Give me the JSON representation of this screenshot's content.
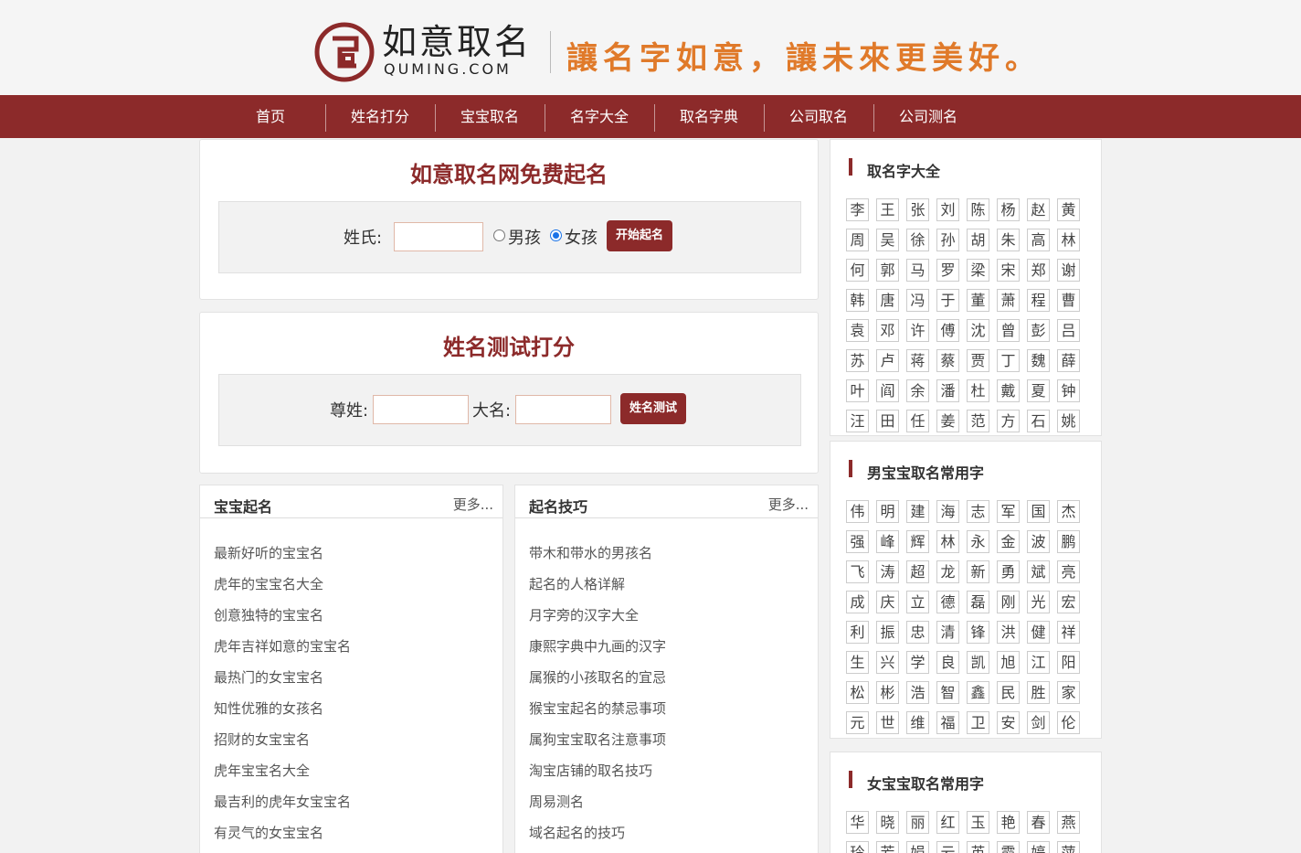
{
  "header": {
    "logo_title": "如意取名",
    "logo_sub": "QUMING.COM",
    "slogan": "讓名字如意，讓未來更美好。"
  },
  "nav": [
    "首页",
    "姓名打分",
    "宝宝取名",
    "名字大全",
    "取名字典",
    "公司取名",
    "公司测名"
  ],
  "naming_form": {
    "title": "如意取名网免费起名",
    "surname_label": "姓氏:",
    "surname_value": "",
    "boy_label": "男孩",
    "girl_label": "女孩",
    "selected_gender": "女孩",
    "submit_label": "开始起名"
  },
  "test_form": {
    "title": "姓名测试打分",
    "surname_label": "尊姓:",
    "surname_value": "",
    "name_label": "大名:",
    "name_value": "",
    "submit_label": "姓名测试"
  },
  "baby_naming": {
    "title": "宝宝起名",
    "more": "更多...",
    "items": [
      "最新好听的宝宝名",
      "虎年的宝宝名大全",
      "创意独特的宝宝名",
      "虎年吉祥如意的宝宝名",
      "最热门的女宝宝名",
      "知性优雅的女孩名",
      "招财的女宝宝名",
      "虎年宝宝名大全",
      "最吉利的虎年女宝宝名",
      "有灵气的女宝宝名"
    ]
  },
  "naming_tips": {
    "title": "起名技巧",
    "more": "更多...",
    "items": [
      "带木和带水的男孩名",
      "起名的人格详解",
      "月字旁的汉字大全",
      "康熙字典中九画的汉字",
      "属猴的小孩取名的宜忌",
      "猴宝宝起名的禁忌事项",
      "属狗宝宝取名注意事项",
      "淘宝店铺的取名技巧",
      "周易测名",
      "域名起名的技巧"
    ]
  },
  "sidebar": {
    "surnames": {
      "title": "取名字大全",
      "chars": [
        "李",
        "王",
        "张",
        "刘",
        "陈",
        "杨",
        "赵",
        "黄",
        "周",
        "吴",
        "徐",
        "孙",
        "胡",
        "朱",
        "高",
        "林",
        "何",
        "郭",
        "马",
        "罗",
        "梁",
        "宋",
        "郑",
        "谢",
        "韩",
        "唐",
        "冯",
        "于",
        "董",
        "萧",
        "程",
        "曹",
        "袁",
        "邓",
        "许",
        "傅",
        "沈",
        "曾",
        "彭",
        "吕",
        "苏",
        "卢",
        "蒋",
        "蔡",
        "贾",
        "丁",
        "魏",
        "薛",
        "叶",
        "阎",
        "余",
        "潘",
        "杜",
        "戴",
        "夏",
        "钟",
        "汪",
        "田",
        "任",
        "姜",
        "范",
        "方",
        "石",
        "姚"
      ]
    },
    "boy_chars": {
      "title": "男宝宝取名常用字",
      "chars": [
        "伟",
        "明",
        "建",
        "海",
        "志",
        "军",
        "国",
        "杰",
        "强",
        "峰",
        "辉",
        "林",
        "永",
        "金",
        "波",
        "鹏",
        "飞",
        "涛",
        "超",
        "龙",
        "新",
        "勇",
        "斌",
        "亮",
        "成",
        "庆",
        "立",
        "德",
        "磊",
        "刚",
        "光",
        "宏",
        "利",
        "振",
        "忠",
        "清",
        "锋",
        "洪",
        "健",
        "祥",
        "生",
        "兴",
        "学",
        "良",
        "凯",
        "旭",
        "江",
        "阳",
        "松",
        "彬",
        "浩",
        "智",
        "鑫",
        "民",
        "胜",
        "家",
        "元",
        "世",
        "维",
        "福",
        "卫",
        "安",
        "剑",
        "伦"
      ]
    },
    "girl_chars": {
      "title": "女宝宝取名常用字",
      "chars": [
        "华",
        "晓",
        "丽",
        "红",
        "玉",
        "艳",
        "春",
        "燕",
        "玲",
        "芳",
        "娟",
        "云",
        "英",
        "霞",
        "婷",
        "萍"
      ]
    }
  },
  "colors": {
    "brand": "#8c2a2a",
    "slogan": "#e07a2a"
  }
}
